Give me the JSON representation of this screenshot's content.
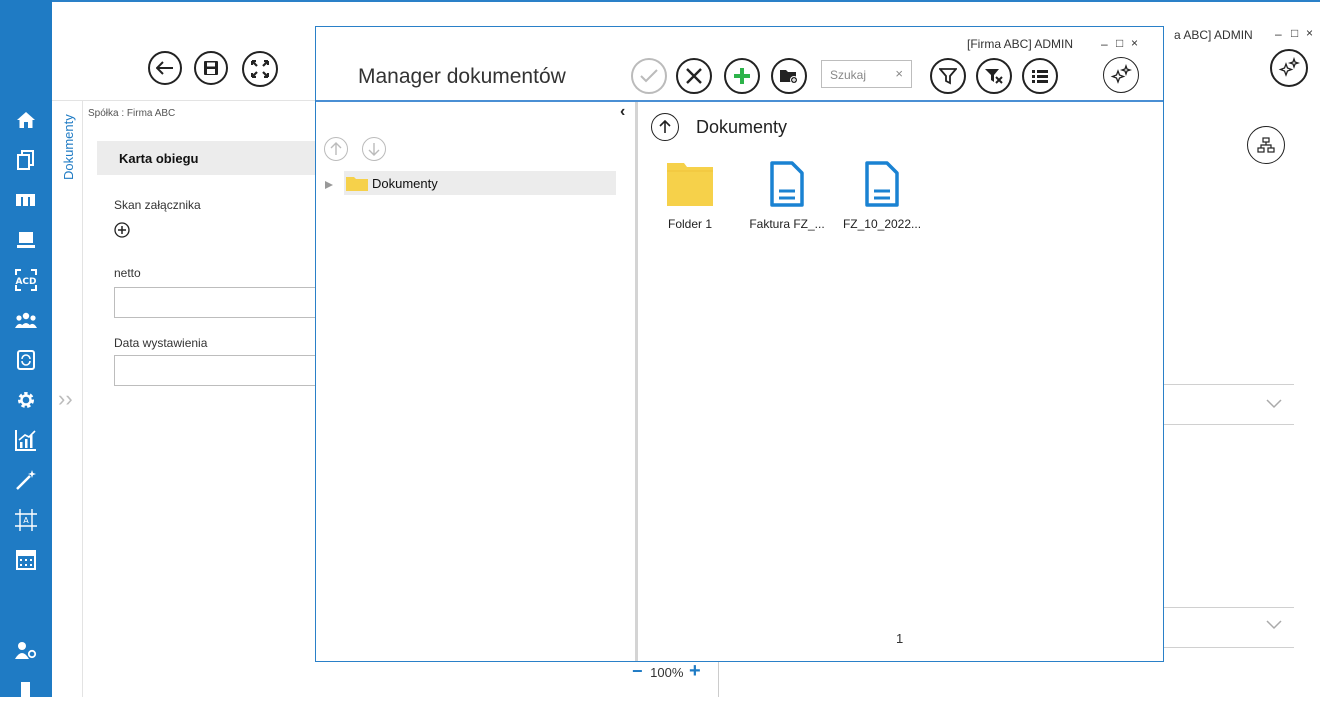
{
  "window": {
    "user_text": "a ABC]  ADMIN",
    "minimize": "–",
    "maximize": "□",
    "close": "×"
  },
  "sidebar": {
    "items": [
      "home-icon",
      "documents-icon",
      "kanban-icon",
      "computer-icon",
      "ocr-icon",
      "users-group-icon",
      "document-refresh-icon",
      "settings-icon",
      "chart-icon",
      "wand-icon",
      "frame-icon",
      "calculator-icon",
      "user-settings-icon",
      "door-icon"
    ]
  },
  "left_panel": {
    "vertical_tab": "Dokumenty",
    "company": "Spółka : Firma ABC",
    "section_title": "Karta obiegu",
    "fields": {
      "attachment_label": "Skan załącznika",
      "netto_label": "netto",
      "netto_value": "",
      "date_label": "Data wystawienia",
      "date_value": ""
    },
    "expand_glyph": "››"
  },
  "dialog": {
    "title": "Manager dokumentów",
    "user_text": "[Firma ABC]  ADMIN",
    "minimize": "–",
    "maximize": "□",
    "close": "×",
    "search": {
      "placeholder": "Szukaj",
      "clear": "×"
    },
    "collapse_glyph": "‹",
    "tree": {
      "root_label": "Dokumenty"
    },
    "breadcrumb": "Dokumenty",
    "files": [
      {
        "name": "Folder 1",
        "type": "folder"
      },
      {
        "name": "Faktura FZ_...",
        "type": "document"
      },
      {
        "name": "FZ_10_2022...",
        "type": "document"
      }
    ],
    "page_number": "1"
  },
  "zoom": {
    "minus": "−",
    "value": "100%",
    "plus": "+"
  },
  "colors": {
    "accent": "#1f7bc4",
    "add_green": "#2db34a",
    "folder_yellow": "#f6d14a",
    "doc_blue": "#1a82d2"
  }
}
